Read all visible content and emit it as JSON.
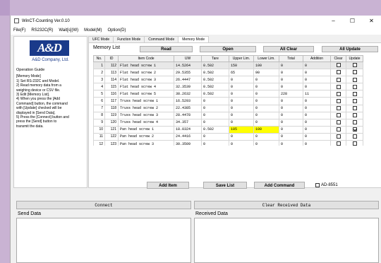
{
  "window": {
    "title": "WinCT-Counting Ver.0.10",
    "controls": [
      "–",
      "☐",
      "✕"
    ]
  },
  "menu": [
    "File(F)",
    "RS232C(R)",
    "Wait[s](W)",
    "Model(M)",
    "Option(D)"
  ],
  "logo": {
    "text": "A&D",
    "company": "A&D Company, Ltd."
  },
  "guide": {
    "title": "Operation Guide",
    "lines": [
      "[Memory Mode]",
      "1) Set RS-232C and Model.",
      "2) Read memory data from a",
      "weighing device or CSV file.",
      "3) Edit [Memory List].",
      "4) When you press the [Add",
      "Command] button, the command",
      "with [Update] checked will be",
      "displayed in [Send Data].",
      "5) Press the [Connect] button and",
      "press the [Send] button to",
      "transmit the data."
    ]
  },
  "tabs": [
    "UFC Mode",
    "Function Mode",
    "Command Mode",
    "Memory Mode"
  ],
  "active_tab": "Memory Mode",
  "memory_list": {
    "label": "Memory List",
    "buttons": {
      "read": "Read",
      "open": "Open",
      "all_clear": "All Clear",
      "all_update": "All Update"
    },
    "columns": [
      "No.",
      "ID",
      "Item Code",
      "UW",
      "Tare",
      "Upper Lim.",
      "Lower Lim.",
      "Total",
      "Addition",
      "Clear",
      "Update"
    ],
    "rows": [
      {
        "no": "1",
        "id": "112",
        "code": "Flat head screw 1",
        "uw": "14.5264",
        "tare": "0.502",
        "upper": "150",
        "lower": "100",
        "total": "0",
        "add": "0",
        "clear": false,
        "update": false
      },
      {
        "no": "2",
        "id": "113",
        "code": "Flat head screw 2",
        "uw": "29.5355",
        "tare": "0.502",
        "upper": "65",
        "lower": "90",
        "total": "0",
        "add": "0",
        "clear": false,
        "update": false
      },
      {
        "no": "3",
        "id": "114",
        "code": "Flat head screw 3",
        "uw": "26.4447",
        "tare": "0.502",
        "upper": "0",
        "lower": "0",
        "total": "0",
        "add": "0",
        "clear": false,
        "update": false
      },
      {
        "no": "4",
        "id": "115",
        "code": "Flat head screw 4",
        "uw": "32.3539",
        "tare": "0.502",
        "upper": "0",
        "lower": "0",
        "total": "0",
        "add": "0",
        "clear": false,
        "update": false
      },
      {
        "no": "5",
        "id": "116",
        "code": "Flat head screw 5",
        "uw": "38.2632",
        "tare": "0.502",
        "upper": "0",
        "lower": "0",
        "total": "228",
        "add": "11",
        "clear": false,
        "update": false
      },
      {
        "no": "6",
        "id": "117",
        "code": "Truss head screw 1",
        "uw": "16.5293",
        "tare": "0",
        "upper": "0",
        "lower": "0",
        "total": "0",
        "add": "0",
        "clear": false,
        "update": false
      },
      {
        "no": "7",
        "id": "118",
        "code": "Truss head screw 2",
        "uw": "22.4385",
        "tare": "0",
        "upper": "0",
        "lower": "0",
        "total": "0",
        "add": "0",
        "clear": false,
        "update": false
      },
      {
        "no": "8",
        "id": "119",
        "code": "Truss head screw 3",
        "uw": "28.4478",
        "tare": "0",
        "upper": "0",
        "lower": "0",
        "total": "0",
        "add": "0",
        "clear": false,
        "update": false
      },
      {
        "no": "9",
        "id": "120",
        "code": "Truss head screw 4",
        "uw": "34.357",
        "tare": "0",
        "upper": "0",
        "lower": "0",
        "total": "0",
        "add": "0",
        "clear": false,
        "update": false
      },
      {
        "no": "10",
        "id": "121",
        "code": "Pan head screw 1",
        "uw": "18.0324",
        "tare": "0.502",
        "upper": "105",
        "lower": "100",
        "total": "0",
        "add": "0",
        "clear": false,
        "update": true,
        "highlight": true
      },
      {
        "no": "11",
        "id": "122",
        "code": "Pan head screw 2",
        "uw": "24.4416",
        "tare": "0",
        "upper": "0",
        "lower": "0",
        "total": "0",
        "add": "0",
        "clear": false,
        "update": false
      },
      {
        "no": "12",
        "id": "123",
        "code": "Pan head screw 3",
        "uw": "30.3509",
        "tare": "0",
        "upper": "0",
        "lower": "0",
        "total": "0",
        "add": "0",
        "clear": false,
        "update": false
      }
    ],
    "selected_row": "1"
  },
  "actions": {
    "add_item": "Add Item",
    "save_list": "Save List",
    "add_command": "Add Command",
    "ad_checkbox": "AD-8551"
  },
  "comm": {
    "connect": "Connect",
    "clear_received": "Clear Received Data",
    "send_label": "Send Data",
    "received_label": "Received Data"
  }
}
